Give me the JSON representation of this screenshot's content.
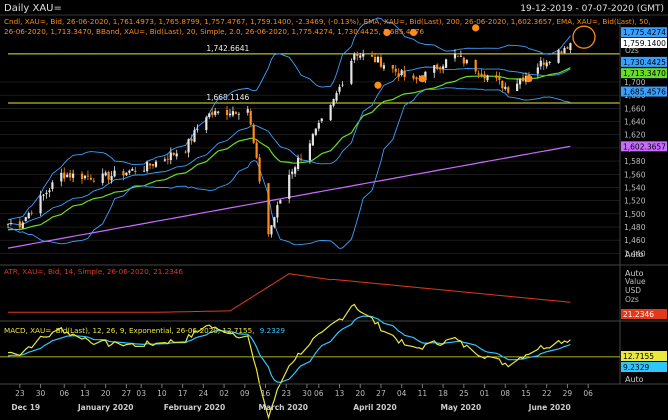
{
  "window": {
    "title": "Daily XAU=",
    "range": "19-12-2019 - 07-07-2020 (GMT)"
  },
  "colors": {
    "bg": "#000000",
    "up": "#e5e5e5",
    "down": "#ff8c1a",
    "ema200": "#c86bff",
    "ema50": "#66dd22",
    "bband": "#3aa0ff",
    "grid": "#2a2a2a",
    "atr": "#e03a1a",
    "macd": "#e8e840",
    "signal": "#2ec6ff",
    "hline": "#e8e830"
  },
  "legends": {
    "main_1": "Cndl, XAU=, Bid, 26-06-2020, 1,761.4973, 1,765.8799, 1,757.4767, 1,759.1400, -2.3469, (-0.13%), EMA, XAU=, Bid(Last), 200, 26-06-2020, 1,602.3657, EMA, XAU=, Bid(Last), 50,",
    "main_2": "26-06-2020, 1,713.3470, BBand, XAU=, Bid(Last), 20, Simple, 2.0, 26-06-2020, 1,775.4274, 1,730.4425, 1,685.4576",
    "atr": "ATR, XAU=, Bid, 14, Simple, 26-06-2020, 21.2346",
    "macd_name": "MACD, XAU=, Bid(Last), 12, 26, 9, Exponential, 26-06-2020, 12.7155,",
    "macd_signal": "9.2329"
  },
  "price_pane": {
    "unit": "Price\nUSD\nOzs",
    "auto": "Auto",
    "yticks": [
      1440,
      1460,
      1480,
      1500,
      1520,
      1540,
      1560,
      1580,
      1600,
      1620,
      1640,
      1660,
      1680,
      1700
    ],
    "ymin": 1430,
    "ymax": 1797,
    "last_labels": [
      {
        "text": "1,775.4274",
        "value": 1775.43,
        "color": "#3aa0ff"
      },
      {
        "text": "1,759.1400",
        "value": 1759.14,
        "color": "#ffffff"
      },
      {
        "text": "1,730.4425",
        "value": 1730.44,
        "color": "#3aa0ff"
      },
      {
        "text": "1,713.3470",
        "value": 1713.35,
        "color": "#66dd22"
      },
      {
        "text": "1,685.4576",
        "value": 1685.46,
        "color": "#3aa0ff"
      },
      {
        "text": "1,602.3657",
        "value": 1602.37,
        "color": "#c86bff"
      }
    ],
    "hlines": [
      {
        "value": 1742.6641,
        "label": "1,742.6641",
        "label_day": 67
      },
      {
        "value": 1668.1146,
        "label": "1,668.1146",
        "label_day": 67
      }
    ]
  },
  "atr_pane": {
    "label_text": "21.2346",
    "unit": "Value\nUSD\nOzs",
    "auto": "Auto",
    "ymin": 10,
    "ymax": 45
  },
  "macd_pane": {
    "last_macd": "12.7155",
    "last_signal": "9.2329",
    "auto": "Auto",
    "ymin": -30,
    "ymax": 40
  },
  "x_axis": {
    "ticks": [
      {
        "day": 4,
        "label": "23"
      },
      {
        "day": 11,
        "label": "30"
      },
      {
        "day": 19,
        "label": "06"
      },
      {
        "day": 26,
        "label": "13"
      },
      {
        "day": 33,
        "label": "20"
      },
      {
        "day": 40,
        "label": "27"
      },
      {
        "day": 45,
        "label": "03"
      },
      {
        "day": 52,
        "label": "10"
      },
      {
        "day": 59,
        "label": "17"
      },
      {
        "day": 66,
        "label": "24"
      },
      {
        "day": 73,
        "label": "02"
      },
      {
        "day": 80,
        "label": "09"
      },
      {
        "day": 87,
        "label": "16"
      },
      {
        "day": 94,
        "label": "23"
      },
      {
        "day": 101,
        "label": "30"
      },
      {
        "day": 105,
        "label": "06"
      },
      {
        "day": 112,
        "label": "13"
      },
      {
        "day": 119,
        "label": "20"
      },
      {
        "day": 126,
        "label": "27"
      },
      {
        "day": 133,
        "label": "04"
      },
      {
        "day": 140,
        "label": "11"
      },
      {
        "day": 147,
        "label": "18"
      },
      {
        "day": 154,
        "label": "25"
      },
      {
        "day": 161,
        "label": "01"
      },
      {
        "day": 168,
        "label": "08"
      },
      {
        "day": 175,
        "label": "15"
      },
      {
        "day": 182,
        "label": "22"
      },
      {
        "day": 189,
        "label": "29"
      },
      {
        "day": 196,
        "label": "06"
      }
    ],
    "months": [
      {
        "day": 6,
        "label": "Dec 19"
      },
      {
        "day": 33,
        "label": "January 2020"
      },
      {
        "day": 63,
        "label": "February 2020"
      },
      {
        "day": 93,
        "label": "March 2020"
      },
      {
        "day": 124,
        "label": "April 2020"
      },
      {
        "day": 153,
        "label": "May 2020"
      },
      {
        "day": 183,
        "label": "June 2020"
      }
    ]
  },
  "chart_data": {
    "type": "line",
    "title": "Daily XAU=",
    "series": [
      {
        "name": "XAU= Bid (close)",
        "x": [
          "2019-12-23",
          "2020-01-06",
          "2020-01-20",
          "2020-02-03",
          "2020-02-17",
          "2020-02-24",
          "2020-03-09",
          "2020-03-16",
          "2020-03-23",
          "2020-04-06",
          "2020-04-14",
          "2020-04-23",
          "2020-05-04",
          "2020-05-18",
          "2020-06-05",
          "2020-06-15",
          "2020-06-26"
        ],
        "y": [
          1485,
          1560,
          1555,
          1570,
          1600,
          1650,
          1660,
          1470,
          1560,
          1660,
          1745,
          1730,
          1700,
          1740,
          1690,
          1725,
          1759.14
        ]
      },
      {
        "name": "EMA 200",
        "x": [
          "2019-12-23",
          "2020-06-26"
        ],
        "y": [
          1448,
          1602.3657
        ]
      },
      {
        "name": "EMA 50",
        "x": [
          "2019-12-23",
          "2020-06-26"
        ],
        "y": [
          1475,
          1713.347
        ]
      },
      {
        "name": "BBand Upper 20",
        "x": [
          "2020-06-26"
        ],
        "y": [
          1775.4274
        ]
      },
      {
        "name": "BBand Middle 20",
        "x": [
          "2020-06-26"
        ],
        "y": [
          1730.4425
        ]
      },
      {
        "name": "BBand Lower 20",
        "x": [
          "2020-06-26"
        ],
        "y": [
          1685.4576
        ]
      },
      {
        "name": "ATR 14",
        "x": [
          "2020-06-26"
        ],
        "y": [
          21.2346
        ]
      },
      {
        "name": "MACD 12,26,9",
        "x": [
          "2020-06-26"
        ],
        "y": [
          12.7155
        ]
      },
      {
        "name": "MACD Signal",
        "x": [
          "2020-06-26"
        ],
        "y": [
          9.2329
        ]
      }
    ],
    "levels": [
      1742.6641,
      1668.1146
    ],
    "ylim": [
      1430,
      1797
    ]
  }
}
